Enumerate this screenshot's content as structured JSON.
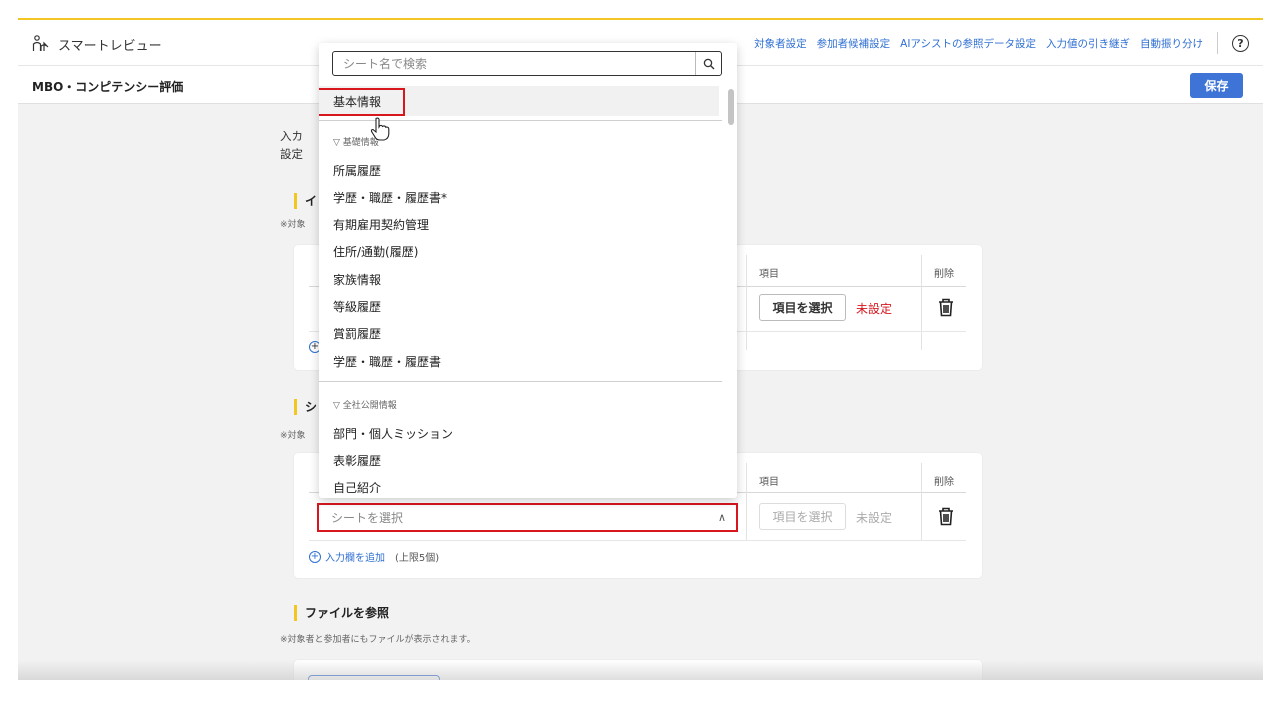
{
  "app": {
    "brand": "スマートレビュー"
  },
  "nav": {
    "links": [
      "対象者設定",
      "参加者候補設定",
      "AIアシストの参照データ設定",
      "入力値の引き継ぎ",
      "自動振り分け"
    ],
    "help_glyph": "?"
  },
  "page": {
    "title": "MBO・コンピテンシー評価",
    "save_label": "保存"
  },
  "intro": {
    "line1": "入カ",
    "line2": "設定"
  },
  "section1": {
    "title": "イ",
    "note": "※対象",
    "col_item": "項目",
    "col_delete": "削除",
    "item_button": "項目を選択",
    "status": "未設定",
    "status_color": "#d7161d"
  },
  "section2": {
    "title": "シ",
    "note": "※対象",
    "col_item": "項目",
    "col_delete": "削除",
    "sheet_placeholder": "シートを選択",
    "item_button": "項目を選択",
    "status": "未設定",
    "add_label": "入力欄を追加",
    "add_limit": "(上限5個)"
  },
  "section3": {
    "title": "ファイルを参照",
    "note": "※対象者と参加者にもファイルが表示されます。"
  },
  "dropdown": {
    "search_placeholder": "シート名で検索",
    "selected": "基本情報",
    "group1": "▽ 基礎情報",
    "group1_items": [
      "所属履歴",
      "学歴・職歴・履歴書*",
      "有期雇用契約管理",
      "住所/通勤(履歴)",
      "家族情報",
      "等級履歴",
      "賞罰履歴",
      "学歴・職歴・履歴書"
    ],
    "group2": "▽ 全社公開情報",
    "group2_items": [
      "部門・個人ミッション",
      "表彰履歴",
      "自己紹介"
    ]
  },
  "colors": {
    "accent": "#f3c623",
    "link": "#2f6fd3",
    "primary": "#3d74d6",
    "highlight": "#d7161d"
  }
}
